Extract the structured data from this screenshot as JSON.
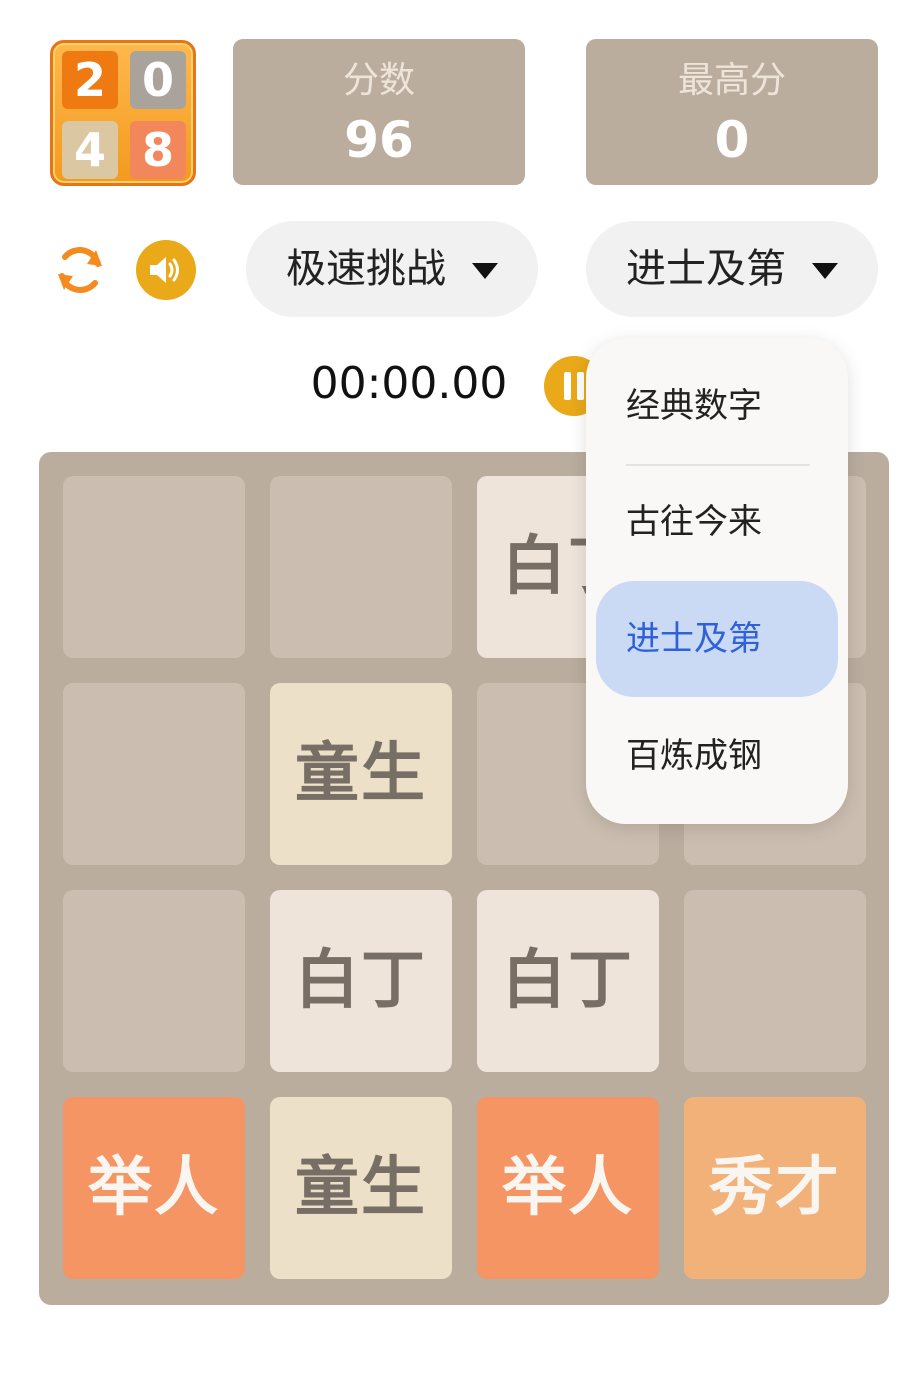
{
  "logo": {
    "digits": [
      "2",
      "0",
      "4",
      "8"
    ]
  },
  "score": {
    "label": "分数",
    "value": "96"
  },
  "best": {
    "label": "最高分",
    "value": "0"
  },
  "controls": {
    "refresh_icon": "refresh-icon",
    "sound_icon": "speaker-icon",
    "mode_select": {
      "value": "极速挑战"
    },
    "level_select": {
      "value": "进士及第"
    }
  },
  "timer": {
    "text": "00:00.00",
    "pause_icon": "pause-icon"
  },
  "dropdown": {
    "options": [
      {
        "label": "经典数字",
        "selected": false
      },
      {
        "label": "古往今来",
        "selected": false
      },
      {
        "label": "进士及第",
        "selected": true
      },
      {
        "label": "百炼成钢",
        "selected": false
      }
    ]
  },
  "board": {
    "rows": [
      [
        "",
        "",
        "白丁",
        ""
      ],
      [
        "",
        "童生",
        "",
        ""
      ],
      [
        "",
        "白丁",
        "白丁",
        ""
      ],
      [
        "举人",
        "童生",
        "举人",
        "秀才"
      ]
    ]
  },
  "colors": {
    "board_bg": "#baad9e",
    "empty_cell": "#cbbeb0",
    "accent": "#e9a919",
    "selected_option_bg": "#cadaf5",
    "selected_option_text": "#2f62d6"
  }
}
